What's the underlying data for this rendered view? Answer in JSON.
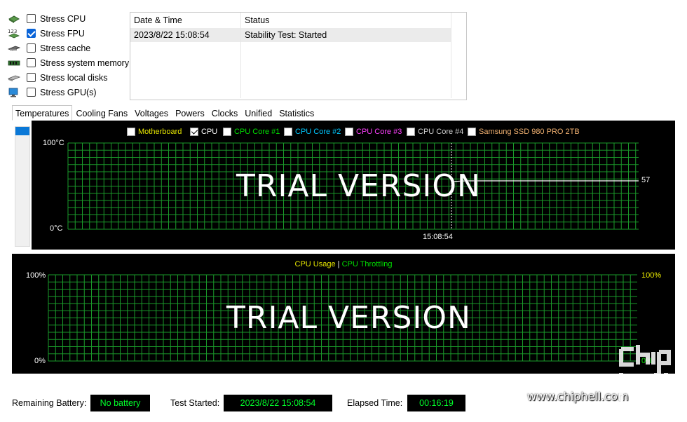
{
  "stress_options": [
    {
      "label": "Stress CPU",
      "checked": false,
      "icon": "cpu-chip-icon"
    },
    {
      "label": "Stress FPU",
      "checked": true,
      "icon": "fpu-123-icon"
    },
    {
      "label": "Stress cache",
      "checked": false,
      "icon": "cache-chip-icon"
    },
    {
      "label": "Stress system memory",
      "checked": false,
      "icon": "memory-module-icon"
    },
    {
      "label": "Stress local disks",
      "checked": false,
      "icon": "disk-drive-icon"
    },
    {
      "label": "Stress GPU(s)",
      "checked": false,
      "icon": "monitor-gpu-icon"
    }
  ],
  "log": {
    "columns": [
      "Date & Time",
      "Status"
    ],
    "rows": [
      [
        "2023/8/22 15:08:54",
        "Stability Test: Started"
      ]
    ]
  },
  "tabs": [
    "Temperatures",
    "Cooling Fans",
    "Voltages",
    "Powers",
    "Clocks",
    "Unified",
    "Statistics"
  ],
  "active_tab": "Temperatures",
  "temp_chart": {
    "legend": [
      {
        "label": "Motherboard",
        "checked": false,
        "color": "#e8e800"
      },
      {
        "label": "CPU",
        "checked": true,
        "color": "#ffffff"
      },
      {
        "label": "CPU Core #1",
        "checked": false,
        "color": "#00e000"
      },
      {
        "label": "CPU Core #2",
        "checked": false,
        "color": "#00c8ff"
      },
      {
        "label": "CPU Core #3",
        "checked": false,
        "color": "#ff40ff"
      },
      {
        "label": "CPU Core #4",
        "checked": false,
        "color": "#d0d0d0"
      },
      {
        "label": "Samsung SSD 980 PRO 2TB",
        "checked": false,
        "color": "#f0b070"
      }
    ],
    "y_top": "100°C",
    "y_bottom": "0°C",
    "x_label": "15:08:54",
    "current_value": "57",
    "watermark": "TRIAL VERSION"
  },
  "usage_chart": {
    "legend_left": "CPU Usage",
    "separator": "|",
    "legend_right": "CPU Throttling",
    "left_top": "100%",
    "left_bottom": "0%",
    "right_top": "100%",
    "right_bottom": "0%",
    "watermark": "TRIAL VERSION"
  },
  "status": {
    "battery_label": "Remaining Battery:",
    "battery_value": "No battery",
    "started_label": "Test Started:",
    "started_value": "2023/8/22 15:08:54",
    "elapsed_label": "Elapsed Time:",
    "elapsed_value": "00:16:19"
  },
  "chart_data": [
    {
      "type": "line",
      "ylim": [
        0,
        100
      ],
      "series": [
        {
          "name": "CPU",
          "x": [
            "15:08:54",
            "now"
          ],
          "values": [
            57,
            57
          ]
        }
      ],
      "grid": true
    },
    {
      "type": "line",
      "ylim": [
        0,
        100
      ],
      "series": [
        {
          "name": "CPU Usage",
          "values": []
        },
        {
          "name": "CPU Throttling",
          "values": [
            0
          ]
        }
      ],
      "grid": true
    }
  ],
  "site_watermark": {
    "url": "www.chiphell.com",
    "logo_text": "chip hell"
  }
}
